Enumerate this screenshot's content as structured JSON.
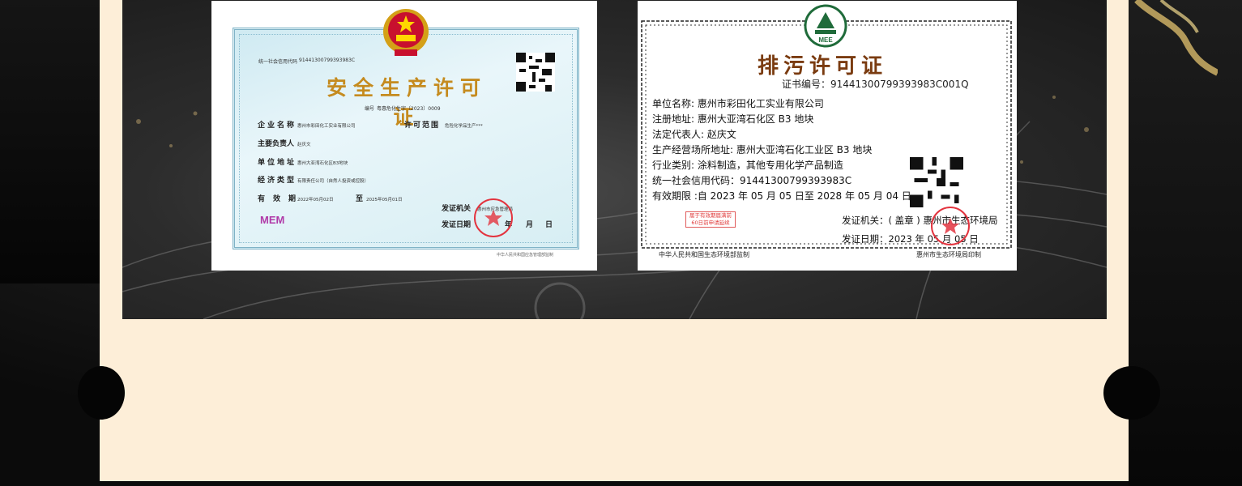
{
  "cert1": {
    "credit_code_label": "统一社会信用代码",
    "credit_code": "91441300799393983C",
    "title": "安全生产许可证",
    "number_label": "编号",
    "number": "粤惠危化生字〔2023〕0009",
    "fields": [
      {
        "label": "企业名称",
        "value": "惠州市彩田化工实业有限公司"
      },
      {
        "label": "主要负责人",
        "value": "赵庆文"
      },
      {
        "label": "单位地址",
        "value": "惠州大亚湾石化区B3地块"
      },
      {
        "label": "经济类型",
        "value": "有限责任公司（自然人投资或控股）"
      }
    ],
    "validity_label": "有效期",
    "valid_from": "2022年05月02日",
    "to_label": "至",
    "valid_to": "2025年05月01日",
    "scope_label": "许可范围",
    "scope_value": "危险化学品生产***",
    "issuer_label": "发证机关",
    "issuer_value": "惠州市应急管理局",
    "issue_date_label": "发证日期",
    "issue_date_month": "月",
    "issue_date_day": "日",
    "issue_date_year_suffix": "年",
    "badge": "MEM",
    "footer": "中华人民共和国应急管理部监制"
  },
  "cert2": {
    "logo_text": "MEE",
    "title": "排污许可证",
    "cert_no": "证书编号：91441300799393983C001Q",
    "lines": [
      "单位名称: 惠州市彩田化工实业有限公司",
      "注册地址: 惠州大亚湾石化区 B3 地块",
      "法定代表人: 赵庆文",
      "生产经营场所地址: 惠州大亚湾石化工业区 B3 地块",
      "行业类别: 涂料制造，其他专用化学产品制造",
      "统一社会信用代码：91441300799393983C",
      "有效期限 :自 2023 年 05 月 05 日至 2028 年 05 月 04 日止"
    ],
    "issuer": "发证机关：( 盖章 ) 惠州市生态环境局",
    "issue_date": "发证日期：2023 年 05 月 05 日",
    "stamp_line1": "届于有效期届满前",
    "stamp_line2": "60日前申请延续",
    "footer_left": "中华人民共和国生态环境部监制",
    "footer_right": "惠州市生态环境局印制"
  },
  "colors": {
    "card_background": "#fdeed8",
    "page_background": "#0a0a0a",
    "cert1_title": "#c58b1f",
    "cert2_title": "#7a3b10",
    "seal_red": "#e3343f"
  }
}
